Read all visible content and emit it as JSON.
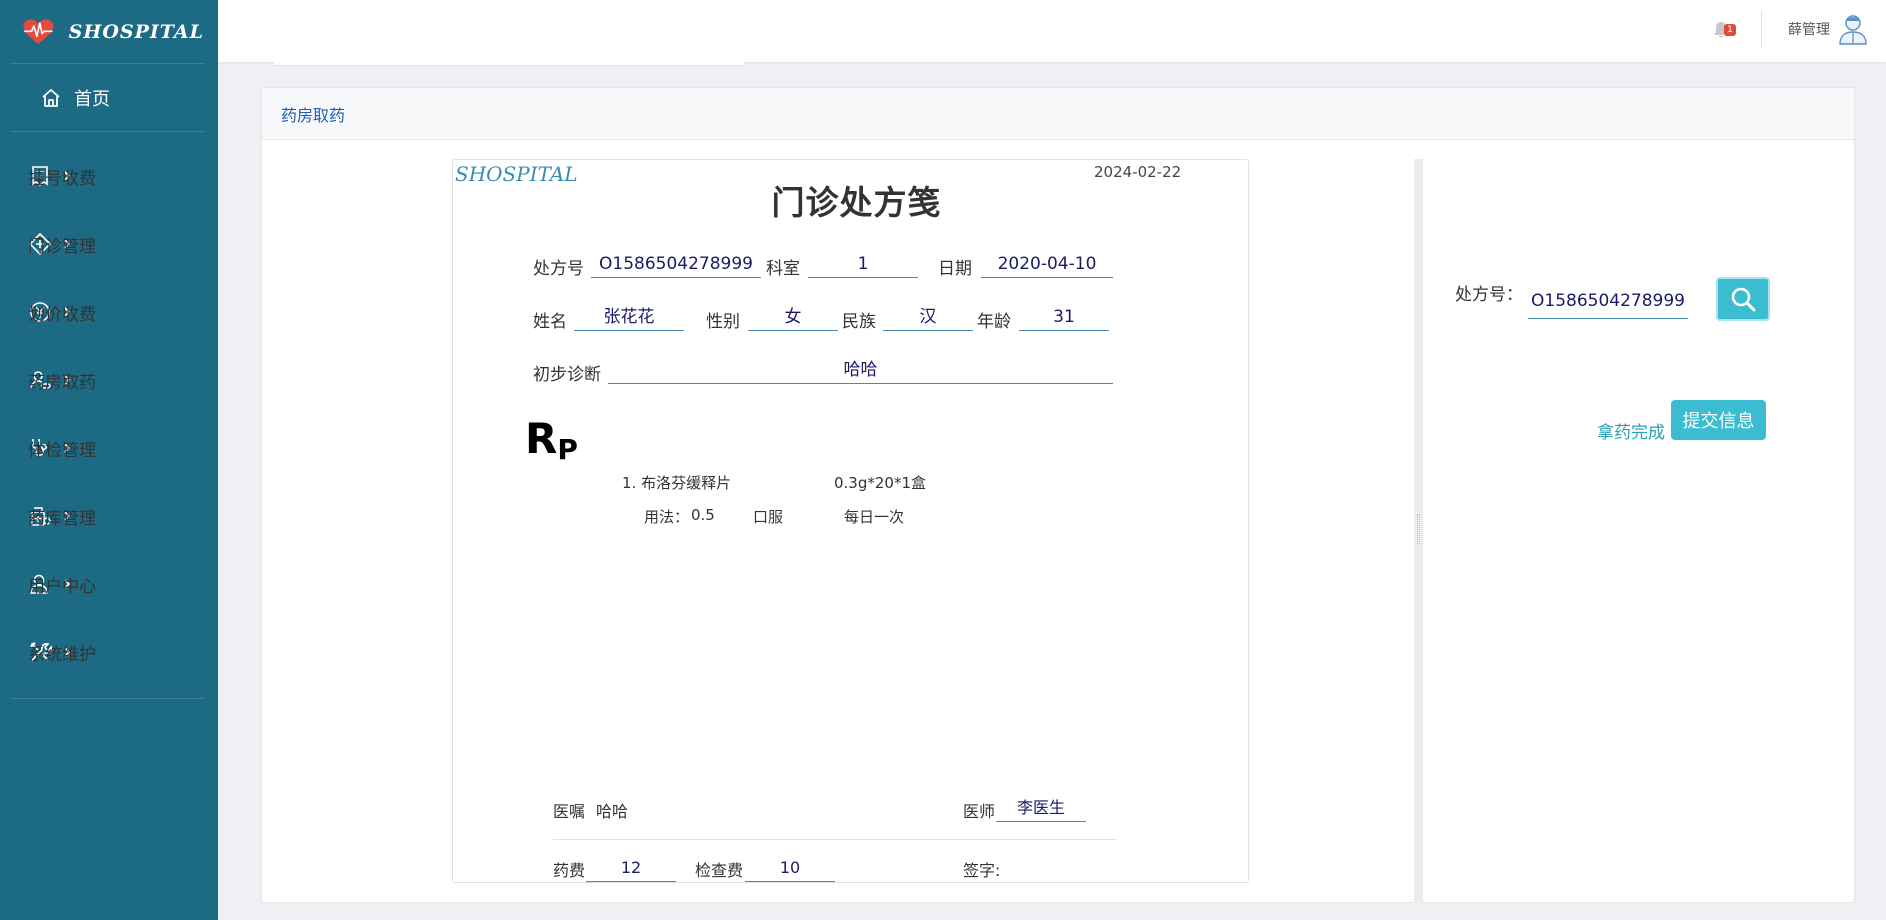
{
  "app": {
    "name": "SHOSPITAL"
  },
  "sidebar": {
    "home_label": "首页",
    "items": [
      {
        "label": "挂号收费",
        "icon": "receipt-icon"
      },
      {
        "label": "门诊管理",
        "icon": "medical-cross-icon"
      },
      {
        "label": "划价收费",
        "icon": "yen-coin-icon"
      },
      {
        "label": "药房取药",
        "icon": "user-pill-icon"
      },
      {
        "label": "体检管理",
        "icon": "stethoscope-icon"
      },
      {
        "label": "药库管理",
        "icon": "medicine-box-icon"
      },
      {
        "label": "用户中心",
        "icon": "user-icon"
      },
      {
        "label": "系统维护",
        "icon": "tools-icon"
      }
    ]
  },
  "topbar": {
    "notification_count": "1",
    "user_name": "薛管理"
  },
  "panel": {
    "title": "药房取药"
  },
  "prescription": {
    "brand": "SHOSPITAL",
    "print_date": "2024-02-22",
    "title": "门诊处方笺",
    "labels": {
      "rx_no": "处方号",
      "dept": "科室",
      "date": "日期",
      "name": "姓名",
      "gender": "性别",
      "ethnicity": "民族",
      "age": "年龄",
      "diagnosis": "初步诊断",
      "advice": "医嘱",
      "doctor": "医师",
      "drug_fee": "药费",
      "exam_fee": "检查费",
      "signature": "签字:"
    },
    "values": {
      "rx_no": "O1586504278999",
      "dept": "1",
      "date": "2020-04-10",
      "name": "张花花",
      "gender": "女",
      "ethnicity": "汉",
      "age": "31",
      "diagnosis": "哈哈",
      "advice": "哈哈",
      "doctor": "李医生",
      "drug_fee": "12",
      "exam_fee": "10"
    },
    "rp": {
      "main": "R",
      "sub": "P"
    },
    "medicines": [
      {
        "line": "1. 布洛芬缓释片",
        "spec": "0.3g*20*1盒",
        "usage_label": "用法：",
        "dose": "0.5",
        "route": "口服",
        "frequency": "每日一次"
      }
    ]
  },
  "search": {
    "label": "处方号：",
    "value": "O1586504278999"
  },
  "actions": {
    "done_label": "拿药完成",
    "submit_label": "提交信息"
  },
  "colors": {
    "sidebar": "#1d6a85",
    "accent": "#3cbcd1",
    "link": "#1f5db3"
  }
}
